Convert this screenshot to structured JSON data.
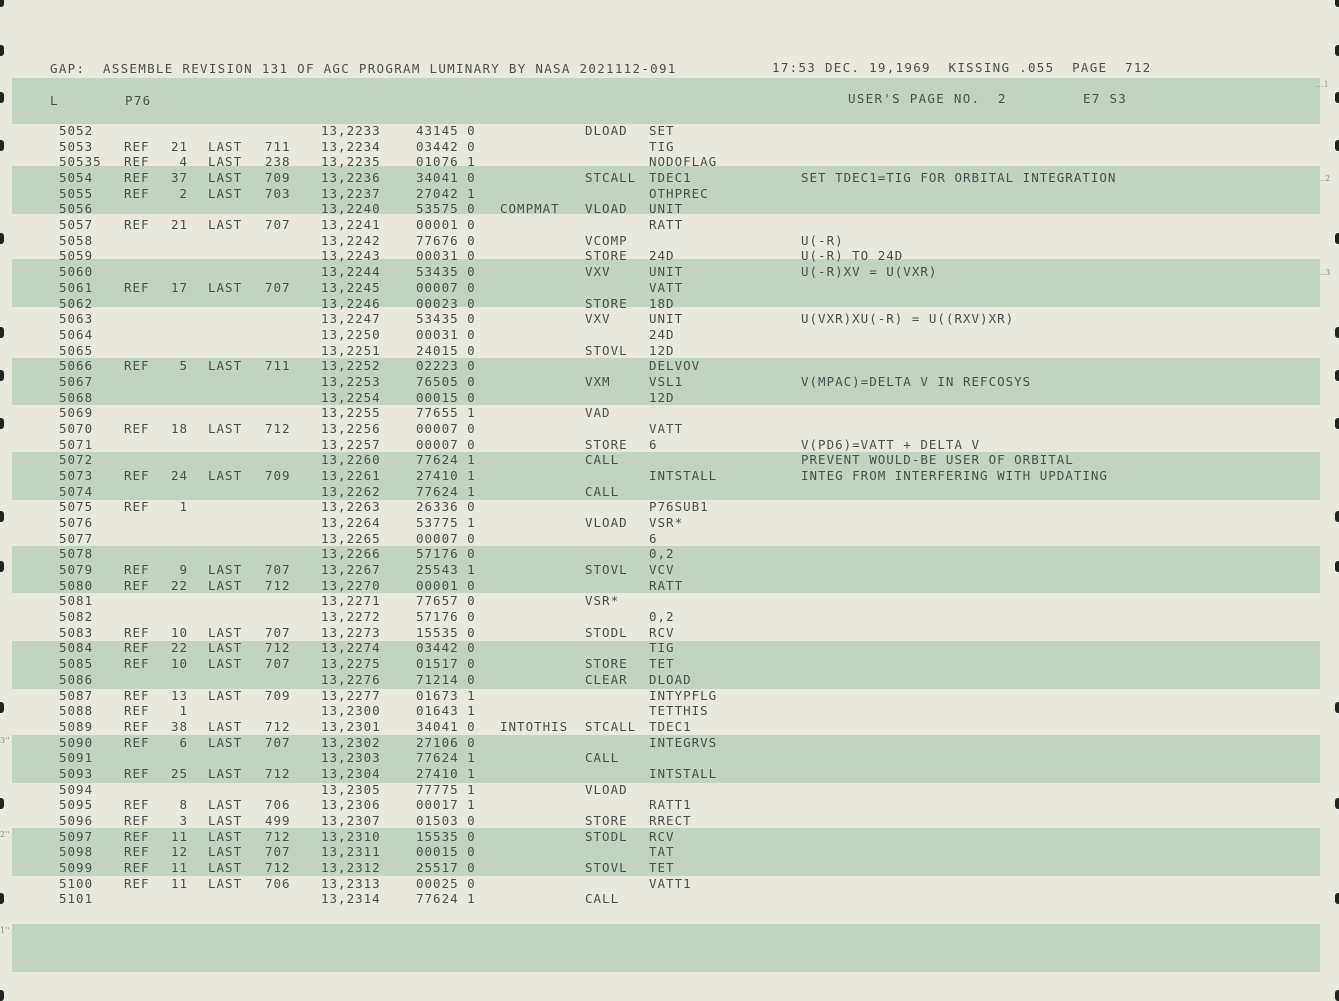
{
  "header": {
    "line1_left": "GAP:  ASSEMBLE REVISION 131 OF AGC PROGRAM LUMINARY BY NASA 2021112-091",
    "line1_right": "17:53 DEC. 19,1969  KISSING .055  PAGE  712",
    "line2_l": "L",
    "line2_log": "P76",
    "line2_right": "USER'S PAGE NO.  2",
    "line2_sheet": "E7 S3"
  },
  "margin_marks": [
    "...1",
    "..2",
    "..3",
    "3''",
    "2''",
    "1''"
  ],
  "rows": [
    {
      "line": "5052",
      "ref": "",
      "refn": "",
      "last": "",
      "lastn": "",
      "addr": "13,2233",
      "word": "43145 0",
      "label": "",
      "op": "DLOAD",
      "operand": "SET",
      "comment": ""
    },
    {
      "line": "5053",
      "ref": "REF",
      "refn": "21",
      "last": "LAST",
      "lastn": "711",
      "addr": "13,2234",
      "word": "03442 0",
      "label": "",
      "op": "",
      "operand": "TIG",
      "comment": ""
    },
    {
      "line": "50535",
      "ref": "REF",
      "refn": "4",
      "last": "LAST",
      "lastn": "238",
      "addr": "13,2235",
      "word": "01076 1",
      "label": "",
      "op": "",
      "operand": "NODOFLAG",
      "comment": ""
    },
    {
      "line": "5054",
      "ref": "REF",
      "refn": "37",
      "last": "LAST",
      "lastn": "709",
      "addr": "13,2236",
      "word": "34041 0",
      "label": "",
      "op": "STCALL",
      "operand": "TDEC1",
      "comment": "SET TDEC1=TIG FOR ORBITAL INTEGRATION"
    },
    {
      "line": "5055",
      "ref": "REF",
      "refn": "2",
      "last": "LAST",
      "lastn": "703",
      "addr": "13,2237",
      "word": "27042 1",
      "label": "",
      "op": "",
      "operand": "OTHPREC",
      "comment": ""
    },
    {
      "line": "5056",
      "ref": "",
      "refn": "",
      "last": "",
      "lastn": "",
      "addr": "13,2240",
      "word": "53575 0",
      "label": "COMPMAT",
      "op": "VLOAD",
      "operand": "UNIT",
      "comment": ""
    },
    {
      "line": "5057",
      "ref": "REF",
      "refn": "21",
      "last": "LAST",
      "lastn": "707",
      "addr": "13,2241",
      "word": "00001 0",
      "label": "",
      "op": "",
      "operand": "RATT",
      "comment": ""
    },
    {
      "line": "5058",
      "ref": "",
      "refn": "",
      "last": "",
      "lastn": "",
      "addr": "13,2242",
      "word": "77676 0",
      "label": "",
      "op": "VCOMP",
      "operand": "",
      "comment": "U(-R)"
    },
    {
      "line": "5059",
      "ref": "",
      "refn": "",
      "last": "",
      "lastn": "",
      "addr": "13,2243",
      "word": "00031 0",
      "label": "",
      "op": "STORE",
      "operand": "24D",
      "comment": "U(-R) TO 24D"
    },
    {
      "line": "5060",
      "ref": "",
      "refn": "",
      "last": "",
      "lastn": "",
      "addr": "13,2244",
      "word": "53435 0",
      "label": "",
      "op": "VXV",
      "operand": "UNIT",
      "comment": "U(-R)XV = U(VXR)"
    },
    {
      "line": "5061",
      "ref": "REF",
      "refn": "17",
      "last": "LAST",
      "lastn": "707",
      "addr": "13,2245",
      "word": "00007 0",
      "label": "",
      "op": "",
      "operand": "VATT",
      "comment": ""
    },
    {
      "line": "5062",
      "ref": "",
      "refn": "",
      "last": "",
      "lastn": "",
      "addr": "13,2246",
      "word": "00023 0",
      "label": "",
      "op": "STORE",
      "operand": "18D",
      "comment": ""
    },
    {
      "line": "5063",
      "ref": "",
      "refn": "",
      "last": "",
      "lastn": "",
      "addr": "13,2247",
      "word": "53435 0",
      "label": "",
      "op": "VXV",
      "operand": "UNIT",
      "comment": "U(VXR)XU(-R) = U((RXV)XR)"
    },
    {
      "line": "5064",
      "ref": "",
      "refn": "",
      "last": "",
      "lastn": "",
      "addr": "13,2250",
      "word": "00031 0",
      "label": "",
      "op": "",
      "operand": "24D",
      "comment": ""
    },
    {
      "line": "5065",
      "ref": "",
      "refn": "",
      "last": "",
      "lastn": "",
      "addr": "13,2251",
      "word": "24015 0",
      "label": "",
      "op": "STOVL",
      "operand": "12D",
      "comment": ""
    },
    {
      "line": "5066",
      "ref": "REF",
      "refn": "5",
      "last": "LAST",
      "lastn": "711",
      "addr": "13,2252",
      "word": "02223 0",
      "label": "",
      "op": "",
      "operand": "DELVOV",
      "comment": ""
    },
    {
      "line": "5067",
      "ref": "",
      "refn": "",
      "last": "",
      "lastn": "",
      "addr": "13,2253",
      "word": "76505 0",
      "label": "",
      "op": "VXM",
      "operand": "VSL1",
      "comment": "V(MPAC)=DELTA V IN REFCOSYS"
    },
    {
      "line": "5068",
      "ref": "",
      "refn": "",
      "last": "",
      "lastn": "",
      "addr": "13,2254",
      "word": "00015 0",
      "label": "",
      "op": "",
      "operand": "12D",
      "comment": ""
    },
    {
      "line": "5069",
      "ref": "",
      "refn": "",
      "last": "",
      "lastn": "",
      "addr": "13,2255",
      "word": "77655 1",
      "label": "",
      "op": "VAD",
      "operand": "",
      "comment": ""
    },
    {
      "line": "5070",
      "ref": "REF",
      "refn": "18",
      "last": "LAST",
      "lastn": "712",
      "addr": "13,2256",
      "word": "00007 0",
      "label": "",
      "op": "",
      "operand": "VATT",
      "comment": ""
    },
    {
      "line": "5071",
      "ref": "",
      "refn": "",
      "last": "",
      "lastn": "",
      "addr": "13,2257",
      "word": "00007 0",
      "label": "",
      "op": "STORE",
      "operand": "6",
      "comment": "V(PD6)=VATT + DELTA V"
    },
    {
      "line": "5072",
      "ref": "",
      "refn": "",
      "last": "",
      "lastn": "",
      "addr": "13,2260",
      "word": "77624 1",
      "label": "",
      "op": "CALL",
      "operand": "",
      "comment": "PREVENT WOULD-BE USER OF ORBITAL"
    },
    {
      "line": "5073",
      "ref": "REF",
      "refn": "24",
      "last": "LAST",
      "lastn": "709",
      "addr": "13,2261",
      "word": "27410 1",
      "label": "",
      "op": "",
      "operand": "INTSTALL",
      "comment": "INTEG FROM INTERFERING WITH UPDATING"
    },
    {
      "line": "5074",
      "ref": "",
      "refn": "",
      "last": "",
      "lastn": "",
      "addr": "13,2262",
      "word": "77624 1",
      "label": "",
      "op": "CALL",
      "operand": "",
      "comment": ""
    },
    {
      "line": "5075",
      "ref": "REF",
      "refn": "1",
      "last": "",
      "lastn": "",
      "addr": "13,2263",
      "word": "26336 0",
      "label": "",
      "op": "",
      "operand": "P76SUB1",
      "comment": ""
    },
    {
      "line": "5076",
      "ref": "",
      "refn": "",
      "last": "",
      "lastn": "",
      "addr": "13,2264",
      "word": "53775 1",
      "label": "",
      "op": "VLOAD",
      "operand": "VSR*",
      "comment": ""
    },
    {
      "line": "5077",
      "ref": "",
      "refn": "",
      "last": "",
      "lastn": "",
      "addr": "13,2265",
      "word": "00007 0",
      "label": "",
      "op": "",
      "operand": "6",
      "comment": ""
    },
    {
      "line": "5078",
      "ref": "",
      "refn": "",
      "last": "",
      "lastn": "",
      "addr": "13,2266",
      "word": "57176 0",
      "label": "",
      "op": "",
      "operand": "0,2",
      "comment": ""
    },
    {
      "line": "5079",
      "ref": "REF",
      "refn": "9",
      "last": "LAST",
      "lastn": "707",
      "addr": "13,2267",
      "word": "25543 1",
      "label": "",
      "op": "STOVL",
      "operand": "VCV",
      "comment": ""
    },
    {
      "line": "5080",
      "ref": "REF",
      "refn": "22",
      "last": "LAST",
      "lastn": "712",
      "addr": "13,2270",
      "word": "00001 0",
      "label": "",
      "op": "",
      "operand": "RATT",
      "comment": ""
    },
    {
      "line": "5081",
      "ref": "",
      "refn": "",
      "last": "",
      "lastn": "",
      "addr": "13,2271",
      "word": "77657 0",
      "label": "",
      "op": "VSR*",
      "operand": "",
      "comment": ""
    },
    {
      "line": "5082",
      "ref": "",
      "refn": "",
      "last": "",
      "lastn": "",
      "addr": "13,2272",
      "word": "57176 0",
      "label": "",
      "op": "",
      "operand": "0,2",
      "comment": ""
    },
    {
      "line": "5083",
      "ref": "REF",
      "refn": "10",
      "last": "LAST",
      "lastn": "707",
      "addr": "13,2273",
      "word": "15535 0",
      "label": "",
      "op": "STODL",
      "operand": "RCV",
      "comment": ""
    },
    {
      "line": "5084",
      "ref": "REF",
      "refn": "22",
      "last": "LAST",
      "lastn": "712",
      "addr": "13,2274",
      "word": "03442 0",
      "label": "",
      "op": "",
      "operand": "TIG",
      "comment": ""
    },
    {
      "line": "5085",
      "ref": "REF",
      "refn": "10",
      "last": "LAST",
      "lastn": "707",
      "addr": "13,2275",
      "word": "01517 0",
      "label": "",
      "op": "STORE",
      "operand": "TET",
      "comment": ""
    },
    {
      "line": "5086",
      "ref": "",
      "refn": "",
      "last": "",
      "lastn": "",
      "addr": "13,2276",
      "word": "71214 0",
      "label": "",
      "op": "CLEAR",
      "operand": "DLOAD",
      "comment": ""
    },
    {
      "line": "5087",
      "ref": "REF",
      "refn": "13",
      "last": "LAST",
      "lastn": "709",
      "addr": "13,2277",
      "word": "01673 1",
      "label": "",
      "op": "",
      "operand": "INTYPFLG",
      "comment": ""
    },
    {
      "line": "5088",
      "ref": "REF",
      "refn": "1",
      "last": "",
      "lastn": "",
      "addr": "13,2300",
      "word": "01643 1",
      "label": "",
      "op": "",
      "operand": "TETTHIS",
      "comment": ""
    },
    {
      "line": "5089",
      "ref": "REF",
      "refn": "38",
      "last": "LAST",
      "lastn": "712",
      "addr": "13,2301",
      "word": "34041 0",
      "label": "INTOTHIS",
      "op": "STCALL",
      "operand": "TDEC1",
      "comment": ""
    },
    {
      "line": "5090",
      "ref": "REF",
      "refn": "6",
      "last": "LAST",
      "lastn": "707",
      "addr": "13,2302",
      "word": "27106 0",
      "label": "",
      "op": "",
      "operand": "INTEGRVS",
      "comment": ""
    },
    {
      "line": "5091",
      "ref": "",
      "refn": "",
      "last": "",
      "lastn": "",
      "addr": "13,2303",
      "word": "77624 1",
      "label": "",
      "op": "CALL",
      "operand": "",
      "comment": ""
    },
    {
      "line": "5093",
      "ref": "REF",
      "refn": "25",
      "last": "LAST",
      "lastn": "712",
      "addr": "13,2304",
      "word": "27410 1",
      "label": "",
      "op": "",
      "operand": "INTSTALL",
      "comment": ""
    },
    {
      "line": "5094",
      "ref": "",
      "refn": "",
      "last": "",
      "lastn": "",
      "addr": "13,2305",
      "word": "77775 1",
      "label": "",
      "op": "VLOAD",
      "operand": "",
      "comment": ""
    },
    {
      "line": "5095",
      "ref": "REF",
      "refn": "8",
      "last": "LAST",
      "lastn": "706",
      "addr": "13,2306",
      "word": "00017 1",
      "label": "",
      "op": "",
      "operand": "RATT1",
      "comment": ""
    },
    {
      "line": "5096",
      "ref": "REF",
      "refn": "3",
      "last": "LAST",
      "lastn": "499",
      "addr": "13,2307",
      "word": "01503 0",
      "label": "",
      "op": "STORE",
      "operand": "RRECT",
      "comment": ""
    },
    {
      "line": "5097",
      "ref": "REF",
      "refn": "11",
      "last": "LAST",
      "lastn": "712",
      "addr": "13,2310",
      "word": "15535 0",
      "label": "",
      "op": "STODL",
      "operand": "RCV",
      "comment": ""
    },
    {
      "line": "5098",
      "ref": "REF",
      "refn": "12",
      "last": "LAST",
      "lastn": "707",
      "addr": "13,2311",
      "word": "00015 0",
      "label": "",
      "op": "",
      "operand": "TAT",
      "comment": ""
    },
    {
      "line": "5099",
      "ref": "REF",
      "refn": "11",
      "last": "LAST",
      "lastn": "712",
      "addr": "13,2312",
      "word": "25517 0",
      "label": "",
      "op": "STOVL",
      "operand": "TET",
      "comment": ""
    },
    {
      "line": "5100",
      "ref": "REF",
      "refn": "11",
      "last": "LAST",
      "lastn": "706",
      "addr": "13,2313",
      "word": "00025 0",
      "label": "",
      "op": "",
      "operand": "VATT1",
      "comment": ""
    },
    {
      "line": "5101",
      "ref": "",
      "refn": "",
      "last": "",
      "lastn": "",
      "addr": "13,2314",
      "word": "77624 1",
      "label": "",
      "op": "CALL",
      "operand": "",
      "comment": ""
    }
  ]
}
